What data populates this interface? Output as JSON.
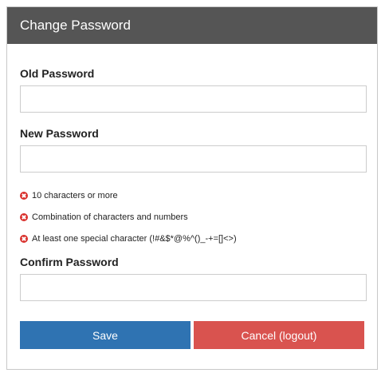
{
  "dialog": {
    "title": "Change Password"
  },
  "old_password": {
    "label": "Old Password",
    "value": "",
    "placeholder": ""
  },
  "new_password": {
    "label": "New Password",
    "value": "",
    "placeholder": ""
  },
  "requirements": [
    {
      "icon": "x-circle-icon",
      "text": "10 characters or more"
    },
    {
      "icon": "x-circle-icon",
      "text": "Combination of characters and numbers"
    },
    {
      "icon": "x-circle-icon",
      "text": "At least one special character (!#&$*@%^()_-+=[]<>)"
    }
  ],
  "confirm_password": {
    "label": "Confirm Password",
    "value": "",
    "placeholder": ""
  },
  "buttons": {
    "save_label": "Save",
    "cancel_label": "Cancel (logout)"
  },
  "colors": {
    "header_bg": "#555555",
    "save_bg": "#2f73b2",
    "cancel_bg": "#d9534f",
    "error_icon": "#d9302c"
  }
}
